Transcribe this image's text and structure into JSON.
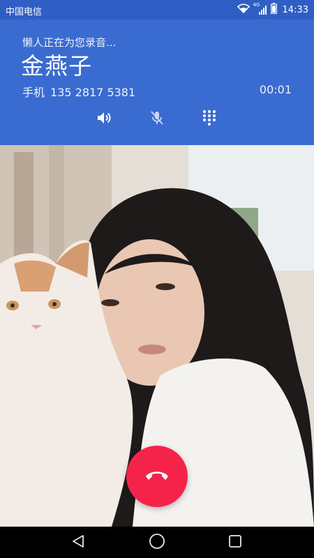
{
  "status_bar": {
    "carrier": "中国电信",
    "network_badge": "4G",
    "time": "14:33",
    "icons": [
      "wifi-icon",
      "signal-icon",
      "battery-icon"
    ]
  },
  "call": {
    "status_text": "懒人正在为您录音...",
    "contact_name": "金燕子",
    "number_type": "手机",
    "number": "135 2817 5381",
    "duration": "00:01",
    "controls": [
      "speaker-icon",
      "mute-mic-icon",
      "dialpad-icon"
    ]
  },
  "end_call": {
    "icon": "phone-hangup-icon",
    "color": "#f5234a"
  },
  "nav": {
    "buttons": [
      "back-icon",
      "home-icon",
      "recent-apps-icon"
    ]
  },
  "colors": {
    "header": "#3a6bd0",
    "status_bar": "#2f5fc4",
    "end_call": "#f5234a"
  }
}
